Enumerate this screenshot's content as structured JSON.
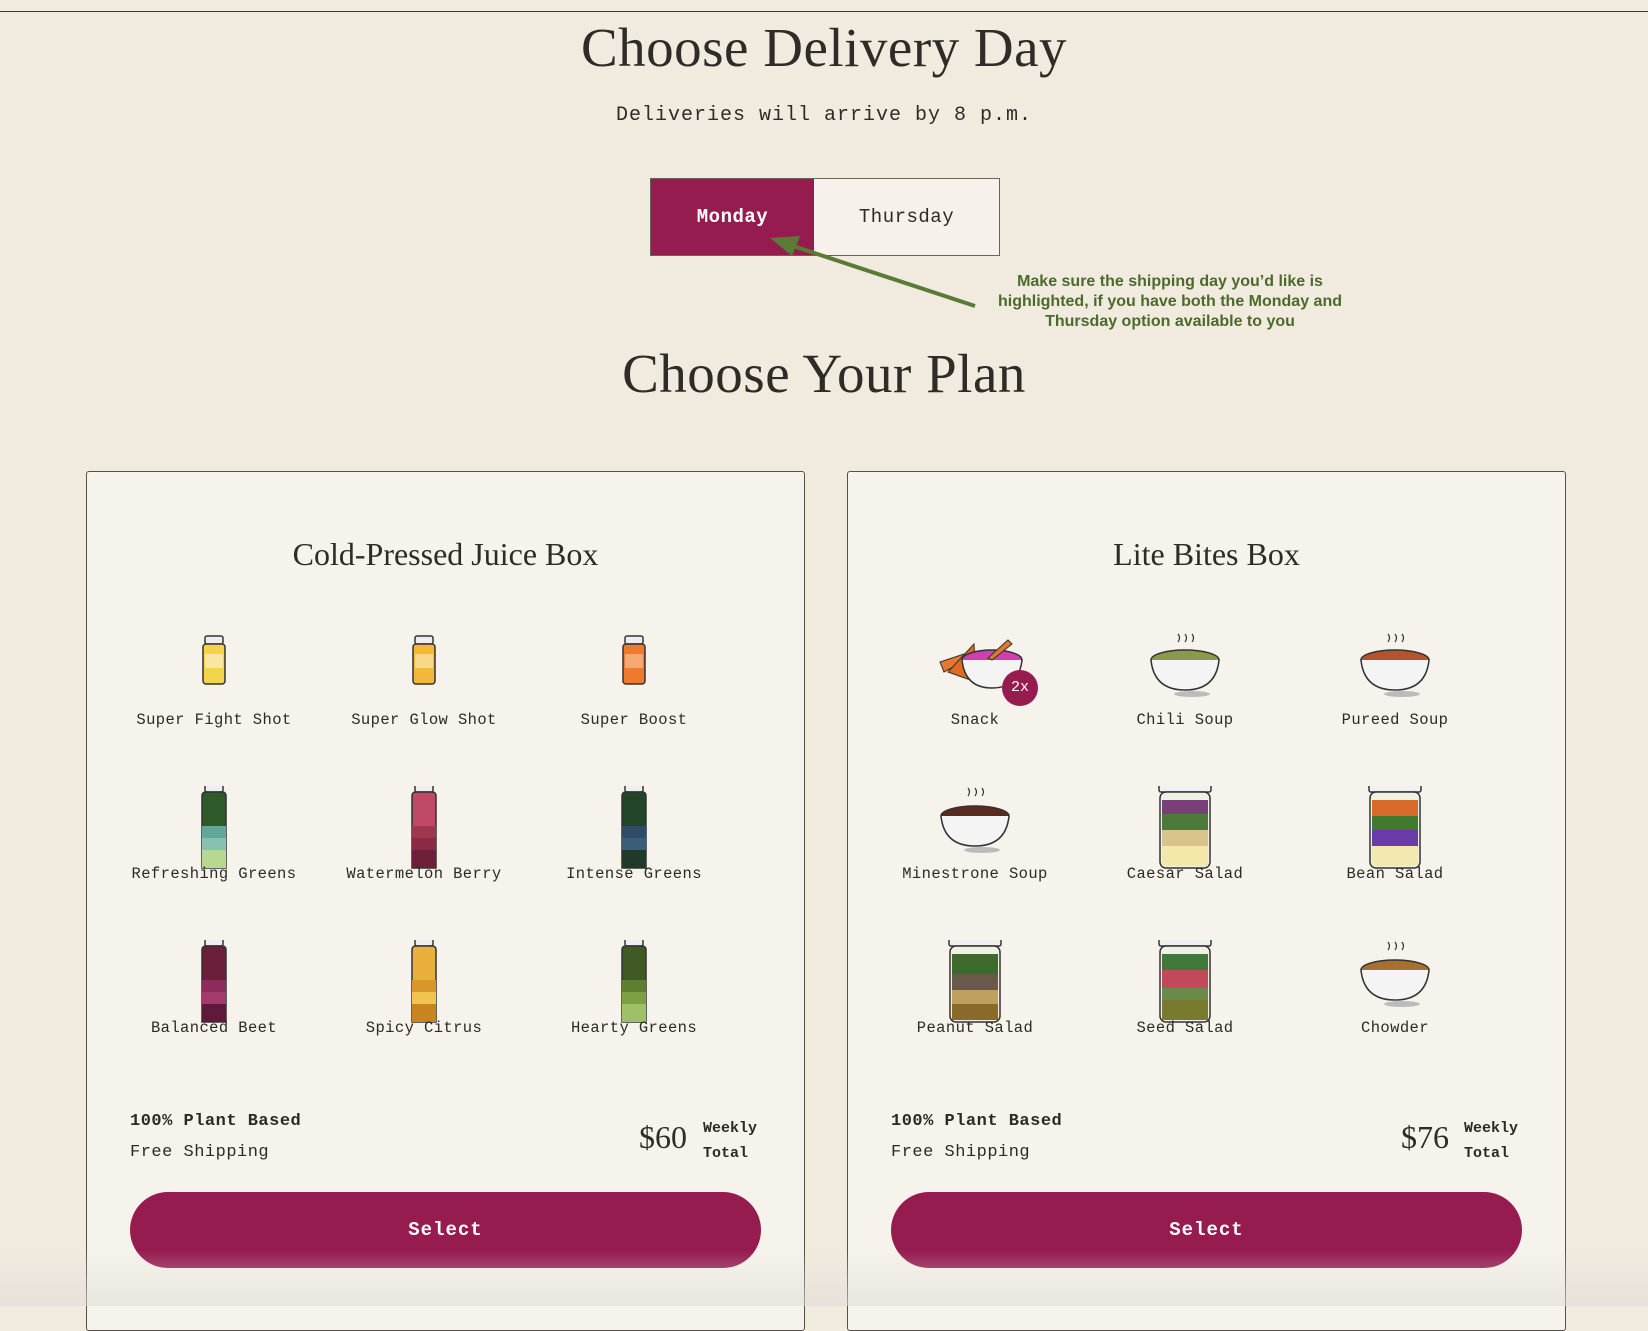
{
  "header": {
    "title": "Choose Delivery Day",
    "subtitle": "Deliveries will arrive by 8 p.m."
  },
  "delivery_toggle": {
    "options": [
      "Monday",
      "Thursday"
    ],
    "selected": "Monday"
  },
  "annotation": {
    "text": "Make sure the shipping day you’d like is highlighted, if you have both the Monday and Thursday option available to you",
    "color": "#4c6a2b"
  },
  "plan_section": {
    "title": "Choose Your Plan"
  },
  "plans": [
    {
      "title": "Cold-Pressed Juice Box",
      "items": [
        "Super Fight Shot",
        "Super Glow Shot",
        "Super Boost",
        "Refreshing Greens",
        "Watermelon Berry",
        "Intense Greens",
        "Balanced Beet",
        "Spicy Citrus",
        "Hearty Greens"
      ],
      "feature1": "100% Plant Based",
      "feature2": "Free Shipping",
      "price": "$60",
      "price_tag": [
        "Weekly",
        "Total"
      ],
      "button": "Select"
    },
    {
      "title": "Lite Bites Box",
      "items": [
        "Snack",
        "Chili Soup",
        "Pureed Soup",
        "Minestrone Soup",
        "Caesar Salad",
        "Bean Salad",
        "Peanut Salad",
        "Seed Salad",
        "Chowder"
      ],
      "snack_badge": "2x",
      "feature1": "100% Plant Based",
      "feature2": "Free Shipping",
      "price": "$76",
      "price_tag": [
        "Weekly",
        "Total"
      ],
      "button": "Select"
    }
  ],
  "colors": {
    "accent": "#961c50",
    "background": "#f1eadf",
    "card": "#f6f2ec"
  }
}
